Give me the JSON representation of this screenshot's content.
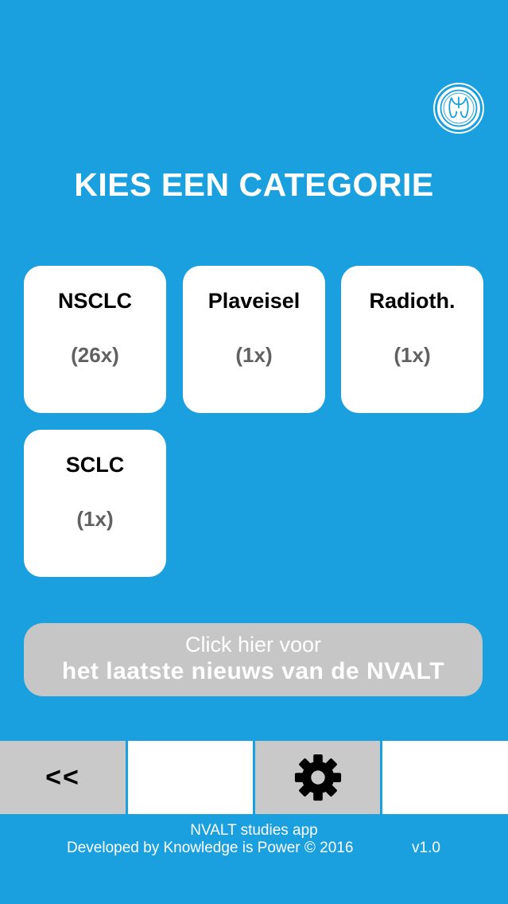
{
  "header": {
    "logo_icon": "lungs-logo-icon",
    "title": "KIES EEN CATEGORIE"
  },
  "categories": [
    {
      "name": "NSCLC",
      "count": "(26x)"
    },
    {
      "name": "Plaveisel",
      "count": "(1x)"
    },
    {
      "name": "Radioth.",
      "count": "(1x)"
    },
    {
      "name": "SCLC",
      "count": "(1x)"
    }
  ],
  "news_button": {
    "line1": "Click hier voor",
    "line2": "het laatste nieuws van de NVALT"
  },
  "toolbar": {
    "back_label": "<<",
    "settings_icon": "gear-icon"
  },
  "footer": {
    "app_name": "NVALT studies app",
    "developer": "Developed by Knowledge is Power  © 2016",
    "version": "v1.0"
  },
  "colors": {
    "background": "#1a9fdf",
    "tile": "#ffffff",
    "news_button": "#c6c6c6",
    "toolbar_gray": "#c9c9c9",
    "count_text": "#616161"
  }
}
